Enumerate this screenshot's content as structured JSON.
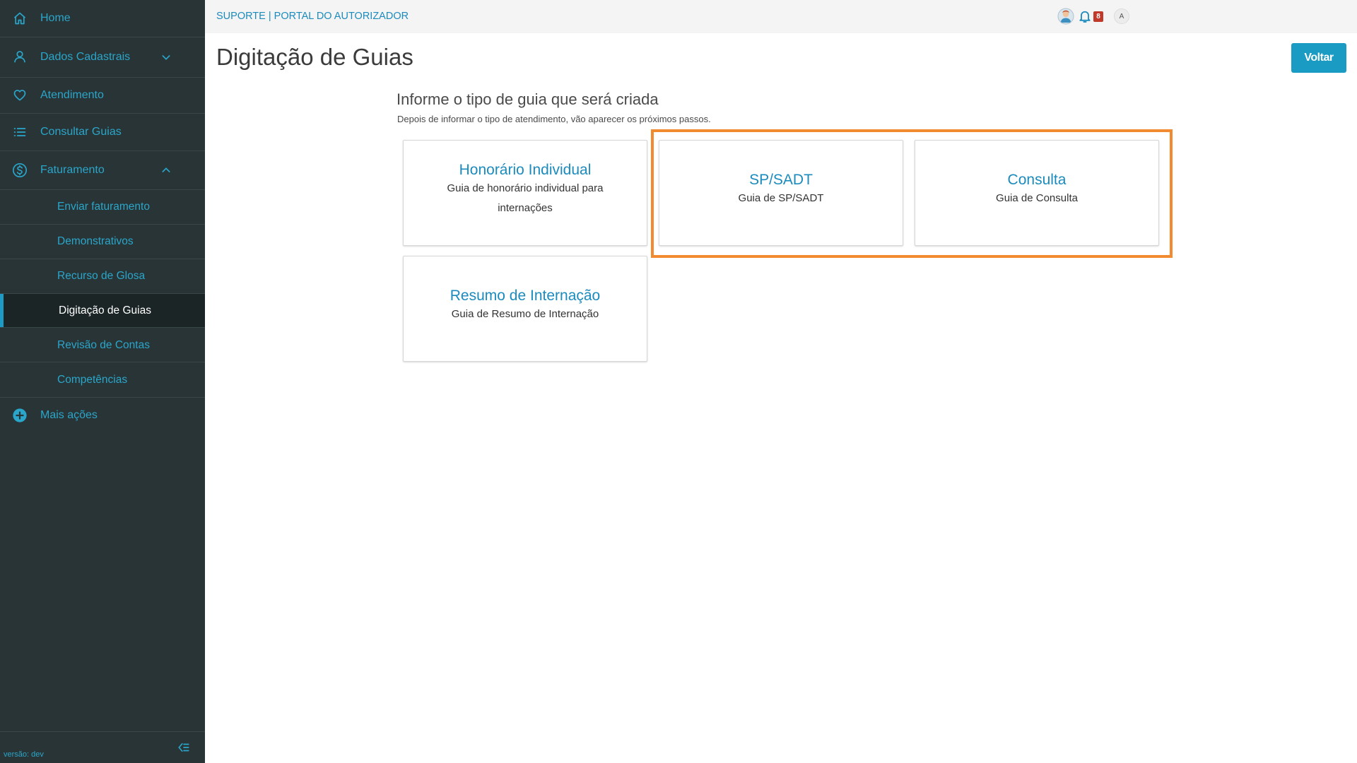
{
  "sidebar": {
    "items": [
      {
        "label": "Home",
        "icon": "home-icon"
      },
      {
        "label": "Dados Cadastrais",
        "icon": "user-icon"
      },
      {
        "label": "Atendimento",
        "icon": "heart-icon"
      },
      {
        "label": "Consultar Guias",
        "icon": "list-icon"
      },
      {
        "label": "Faturamento",
        "icon": "dollar-circle-icon"
      }
    ],
    "sub_items": [
      {
        "label": "Enviar faturamento"
      },
      {
        "label": "Demonstrativos"
      },
      {
        "label": "Recurso de Glosa"
      },
      {
        "label": "Digitação de Guias"
      },
      {
        "label": "Revisão de Contas"
      },
      {
        "label": "Competências"
      }
    ],
    "more_actions": "Mais ações",
    "version": "versão: dev"
  },
  "header": {
    "brand": "SUPORTE | PORTAL DO AUTORIZADOR",
    "notification_count": "8",
    "user_initial": "A"
  },
  "page": {
    "title": "Digitação de Guias",
    "back_label": "Voltar"
  },
  "section": {
    "title": "Informe o tipo de guia que será criada",
    "subtitle": "Depois de informar o tipo de atendimento, vão aparecer os próximos passos."
  },
  "cards": [
    {
      "title": "Honorário Individual",
      "desc": "Guia de honorário individual para internações"
    },
    {
      "title": "SP/SADT",
      "desc": "Guia de SP/SADT"
    },
    {
      "title": "Consulta",
      "desc": "Guia de Consulta"
    },
    {
      "title": "Resumo de Internação",
      "desc": "Guia de Resumo de Internação"
    }
  ],
  "colors": {
    "sidebar_bg": "#283435",
    "accent": "#1a9bc3",
    "highlight": "#f28a30",
    "badge": "#c0392b"
  }
}
